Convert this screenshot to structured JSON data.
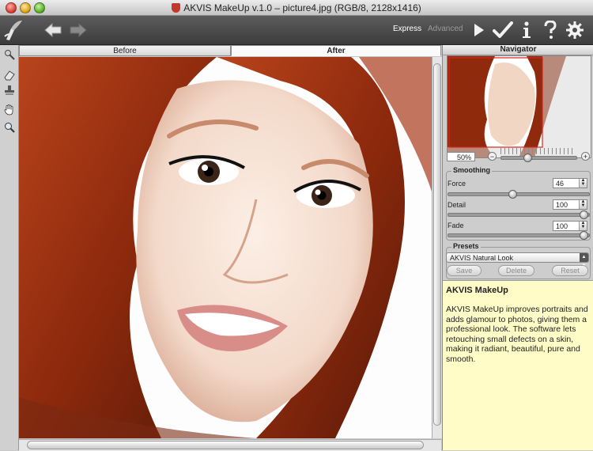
{
  "window": {
    "title": "AKVIS MakeUp v.1.0 – picture4.jpg (RGB/8, 2128x1416)"
  },
  "toolbar": {
    "mode_express": "Express",
    "mode_advanced": "Advanced"
  },
  "view_tabs": [
    {
      "label": "Before"
    },
    {
      "label": "After"
    }
  ],
  "navigator": {
    "title": "Navigator",
    "zoom_value": "50%",
    "zoom_slider_fraction": 0.35
  },
  "smoothing": {
    "title": "Smoothing",
    "params": [
      {
        "label": "Force",
        "value": "46",
        "fraction": 0.46
      },
      {
        "label": "Detail",
        "value": "100",
        "fraction": 1.0
      },
      {
        "label": "Fade",
        "value": "100",
        "fraction": 1.0
      }
    ]
  },
  "presets": {
    "title": "Presets",
    "selected": "AKVIS Natural Look",
    "buttons": {
      "save": "Save",
      "delete": "Delete",
      "reset": "Reset"
    }
  },
  "help": {
    "heading": "AKVIS MakeUp",
    "body": "AKVIS MakeUp improves portraits and adds glamour to photos, giving them a professional look. The software lets retouching small defects on a skin, making it radiant, beautiful, pure and smooth."
  }
}
